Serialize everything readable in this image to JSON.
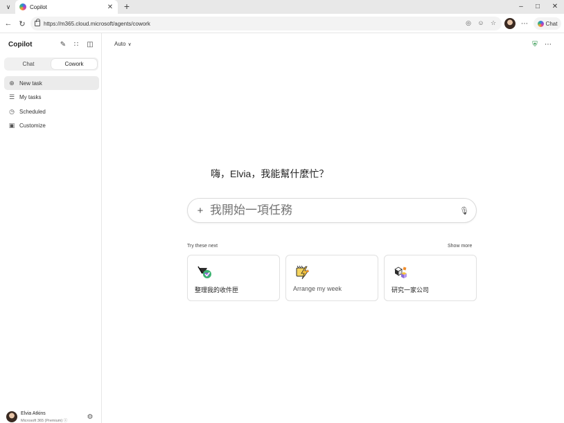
{
  "browser": {
    "tab_title": "Copilot",
    "url": "https://m365.cloud.microsoft/agents/cowork",
    "chat_button_label": "Chat"
  },
  "sidebar": {
    "brand": "Copilot",
    "segments": [
      "Chat",
      "Cowork"
    ],
    "active_segment": "Cowork",
    "items": [
      {
        "label": "New task",
        "icon": "plus-circle-icon"
      },
      {
        "label": "My tasks",
        "icon": "list-icon"
      },
      {
        "label": "Scheduled",
        "icon": "clock-icon"
      },
      {
        "label": "Customize",
        "icon": "briefcase-icon"
      }
    ],
    "user": {
      "name": "Elvia Atkins",
      "plan": "Microsoft 365 (Premium)"
    }
  },
  "main": {
    "model_select": "Auto",
    "greeting": "嗨，Elvia，我能幫什麼忙？",
    "prompt": {
      "value": "我開始一項任務",
      "placeholder": "我開始一項任務"
    },
    "try_label": "Try these next",
    "show_more": "Show more",
    "cards": [
      {
        "label": "整理我的收件匣",
        "icon": "inbox-organize-icon"
      },
      {
        "label": "Arrange my week",
        "icon": "calendar-lightning-icon"
      },
      {
        "label": "研究一家公司",
        "icon": "research-cubes-icon"
      }
    ]
  },
  "colors": {
    "shield": "#1a8a3a",
    "active_nav_bg": "#ebebeb",
    "segment_bg": "#f0f0f0"
  }
}
